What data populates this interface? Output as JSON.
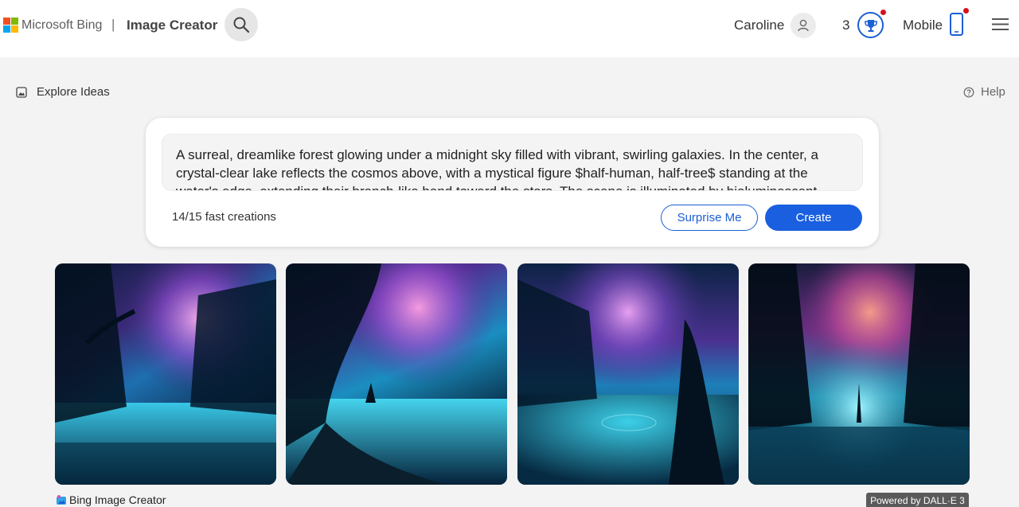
{
  "header": {
    "brand": "Microsoft Bing",
    "separator": "|",
    "app_title": "Image Creator",
    "user_name": "Caroline",
    "reward_count": "3",
    "mobile_label": "Mobile"
  },
  "icons": {
    "search": "search-icon",
    "avatar": "user-icon",
    "rewards": "trophy-icon",
    "mobile": "phone-icon",
    "menu": "hamburger-icon",
    "explore": "image-icon",
    "help": "help-circle-icon"
  },
  "toolbar": {
    "explore_label": "Explore Ideas",
    "help_label": "Help"
  },
  "prompt": {
    "text": " A surreal, dreamlike forest glowing under a midnight sky filled with vibrant, swirling galaxies. In the center, a crystal-clear lake reflects the cosmos above, with a mystical figure $half-human, half-tree$ standing at the water's edge, extending their branch-like hand toward the stars. The scene is illuminated by bioluminescent",
    "fast_creations": "14/15 fast creations",
    "surprise_label": "Surprise Me",
    "create_label": "Create"
  },
  "footer": {
    "app_label": "Bing Image Creator",
    "badge": "Powered by DALL·E 3"
  },
  "colors": {
    "accent": "#1a5fe0",
    "notification": "#d8101b",
    "page_bg": "#f3f3f3"
  }
}
